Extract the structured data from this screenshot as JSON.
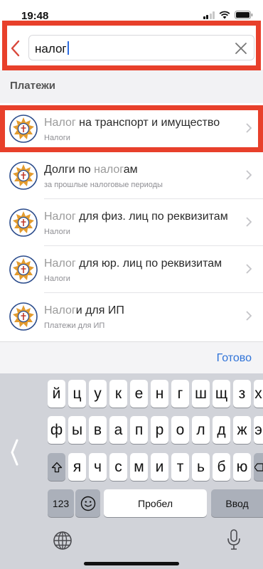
{
  "status_bar": {
    "time": "19:48"
  },
  "search": {
    "query": "налог"
  },
  "section": {
    "title": "Платежи"
  },
  "items": [
    {
      "highlight": "Налог",
      "rest": " на транспорт и имущество",
      "subtitle": "Налоги"
    },
    {
      "highlight": "Долги по ",
      "rest": "",
      "mid_hl": "налог",
      "tail": "ам",
      "subtitle": "за прошлые налоговые периоды"
    },
    {
      "highlight": "Налог",
      "rest": " для физ. лиц по реквизитам",
      "subtitle": "Налоги"
    },
    {
      "highlight": "Налог",
      "rest": " для юр. лиц по реквизитам",
      "subtitle": "Налоги"
    },
    {
      "highlight": "Налог",
      "rest": "и для ИП",
      "subtitle": "Платежи для ИП"
    }
  ],
  "toolbar": {
    "done_label": "Готово"
  },
  "keyboard": {
    "row1": [
      "й",
      "ц",
      "у",
      "к",
      "е",
      "н",
      "г",
      "ш",
      "щ",
      "з",
      "х"
    ],
    "row2": [
      "ф",
      "ы",
      "в",
      "а",
      "п",
      "р",
      "о",
      "л",
      "д",
      "ж",
      "э"
    ],
    "row3": [
      "я",
      "ч",
      "с",
      "м",
      "и",
      "т",
      "ь",
      "б",
      "ю"
    ],
    "numbers_label": "123",
    "space_label": "Пробел",
    "enter_label": "Ввод"
  },
  "colors": {
    "accent": "#2f73d8",
    "annotation": "#e8402b",
    "back_arrow": "#d9473a"
  },
  "icons": [
    "back-arrow-icon",
    "clear-icon",
    "emblem-icon",
    "chevron-right-icon",
    "shift-icon",
    "backspace-icon",
    "emoji-icon",
    "globe-icon",
    "microphone-icon"
  ]
}
